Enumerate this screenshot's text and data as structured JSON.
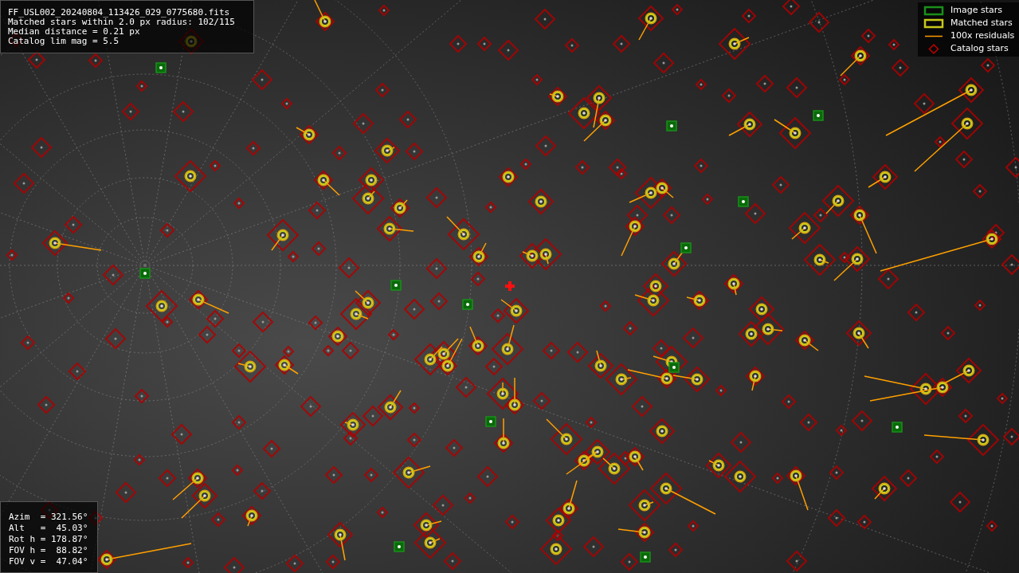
{
  "info_panel": {
    "lines": [
      "FF_USL002_20240804_113426_029_0775680.fits",
      "Matched stars within 2.0 px radius: 102/115",
      "Median distance = 0.21 px",
      "Catalog lim mag = 5.5"
    ]
  },
  "legend": [
    {
      "kind": "image",
      "label": "Image stars"
    },
    {
      "kind": "matched",
      "label": "Matched stars"
    },
    {
      "kind": "residual",
      "label": "100x residuals"
    },
    {
      "kind": "catalog",
      "label": "Catalog stars"
    }
  ],
  "pointing_panel": {
    "lines": [
      "Azim  = 321.56°",
      "Alt   =  45.03°",
      "Rot h = 178.87°",
      "FOV h =  88.82°",
      "FOV v =  47.04°"
    ]
  }
}
